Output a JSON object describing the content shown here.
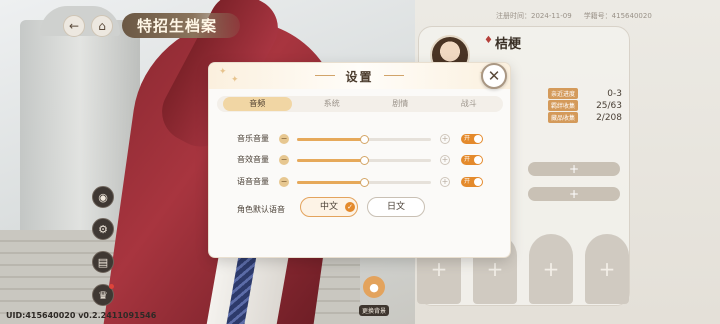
{
  "header": {
    "back_icon": "back-arrow-icon",
    "home_icon": "home-icon",
    "title": "特招生档案",
    "register_time": "注册时间：2024-11-09",
    "student_id": "学籍号：415640020"
  },
  "profile": {
    "name": "桔梗",
    "stats": [
      {
        "label": "亲近进度",
        "value": "0-3"
      },
      {
        "label": "羁绊收集",
        "value": "25/63"
      },
      {
        "label": "藏品收集",
        "value": "2/208"
      }
    ],
    "add_symbol": "+"
  },
  "sidebar": {
    "buttons": [
      "voice-icon",
      "settings-gear-icon",
      "inbox-icon",
      "trophy-icon"
    ]
  },
  "change_background": {
    "label": "更换背景"
  },
  "uid_text": "UID:415640020  v0.2.2411091546",
  "settings": {
    "title": "设置",
    "close_symbol": "✕",
    "tabs": [
      {
        "label": "音频",
        "active": true
      },
      {
        "label": "系统",
        "active": false
      },
      {
        "label": "剧情",
        "active": false
      },
      {
        "label": "战斗",
        "active": false
      }
    ],
    "volumes": [
      {
        "label": "音乐音量",
        "level": 0.5,
        "toggle": "开"
      },
      {
        "label": "音效音量",
        "level": 0.5,
        "toggle": "开"
      },
      {
        "label": "语音音量",
        "level": 0.5,
        "toggle": "开"
      }
    ],
    "minus_symbol": "−",
    "plus_symbol": "+",
    "voice_language": {
      "label": "角色默认语音",
      "options": [
        {
          "label": "中文",
          "selected": true
        },
        {
          "label": "日文",
          "selected": false
        }
      ]
    }
  },
  "colors": {
    "accent": "#e48a2c",
    "tab_active": "#f1d6a4",
    "coat_red": "#a8353f"
  }
}
